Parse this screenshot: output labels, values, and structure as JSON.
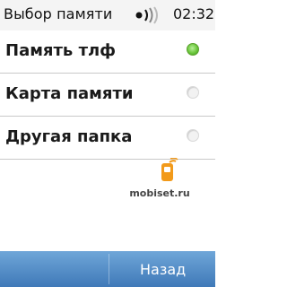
{
  "header": {
    "title": "Выбор памяти",
    "time": "02:32",
    "icons": [
      "signal-icon"
    ]
  },
  "options": [
    {
      "label": "Память тлф",
      "selected": true
    },
    {
      "label": "Карта памяти",
      "selected": false
    },
    {
      "label": "Другая папка",
      "selected": false
    }
  ],
  "watermark": {
    "text": "mobiset.ru",
    "icon": "mobiset-logo-icon"
  },
  "softkeys": {
    "back": "Назад"
  },
  "colors": {
    "accent": "#4f8cc9",
    "radio_on": "#6cc73c",
    "divider": "#c9c9c9"
  }
}
